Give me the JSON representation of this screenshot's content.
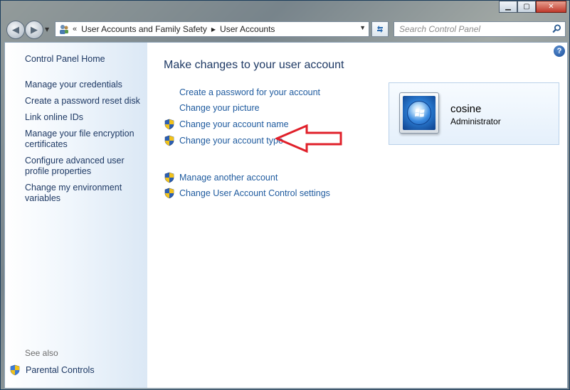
{
  "window": {
    "minimize_glyph": "▁",
    "maximize_glyph": "▢",
    "close_glyph": "✕"
  },
  "navigation": {
    "back_glyph": "◀",
    "forward_glyph": "▶",
    "address_prefix": "«",
    "breadcrumb": [
      "User Accounts and Family Safety",
      "User Accounts"
    ],
    "breadcrumb_separator": "▶",
    "search_placeholder": "Search Control Panel"
  },
  "sidebar": {
    "home": "Control Panel Home",
    "items": [
      "Manage your credentials",
      "Create a password reset disk",
      "Link online IDs",
      "Manage your file encryption certificates",
      "Configure advanced user profile properties",
      "Change my environment variables"
    ],
    "see_also_label": "See also",
    "see_also_items": [
      "Parental Controls"
    ]
  },
  "main": {
    "help_glyph": "?",
    "title": "Make changes to your user account",
    "tasks": [
      {
        "label": "Create a password for your account",
        "shield": false
      },
      {
        "label": "Change your picture",
        "shield": false
      },
      {
        "label": "Change your account name",
        "shield": true
      },
      {
        "label": "Change your account type",
        "shield": true
      },
      {
        "label": "Manage another account",
        "shield": true
      },
      {
        "label": "Change User Account Control settings",
        "shield": true
      }
    ]
  },
  "account": {
    "name": "cosine",
    "role": "Administrator"
  },
  "colors": {
    "link": "#1e5a9e",
    "nav_text": "#1e3964",
    "annotation_arrow": "#e0202a"
  },
  "icons": {
    "shield": "uac-shield-icon",
    "search": "search-icon",
    "help": "help-icon",
    "refresh": "refresh-icon"
  }
}
